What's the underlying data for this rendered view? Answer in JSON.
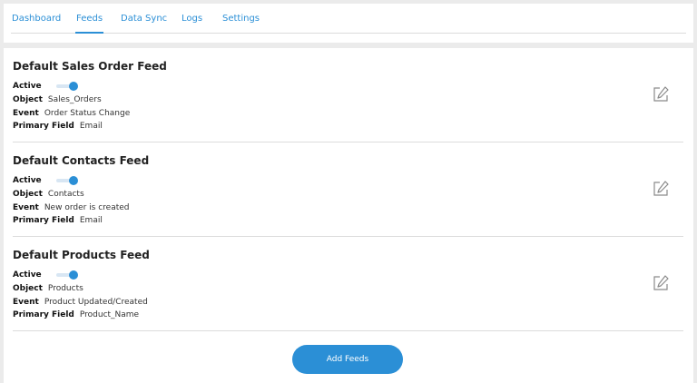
{
  "nav": {
    "tabs": [
      {
        "label": "Dashboard"
      },
      {
        "label": "Feeds",
        "active": true
      },
      {
        "label": "Data Sync"
      },
      {
        "label": "Logs"
      },
      {
        "label": "Settings"
      }
    ]
  },
  "labels": {
    "active": "Active",
    "object": "Object",
    "event": "Event",
    "primary_field": "Primary Field"
  },
  "feeds": [
    {
      "title": "Default Sales Order Feed",
      "active": true,
      "object": "Sales_Orders",
      "event": "Order Status Change",
      "primary_field": "Email"
    },
    {
      "title": "Default Contacts Feed",
      "active": true,
      "object": "Contacts",
      "event": "New order is created",
      "primary_field": "Email"
    },
    {
      "title": "Default Products Feed",
      "active": true,
      "object": "Products",
      "event": "Product Updated/Created",
      "primary_field": "Product_Name"
    }
  ],
  "add_button": {
    "label": "Add Feeds"
  },
  "colors": {
    "accent": "#2b8fd6",
    "divider": "#dcdcdc",
    "background": "#ebebeb"
  },
  "icons": {
    "edit": "edit-icon"
  }
}
